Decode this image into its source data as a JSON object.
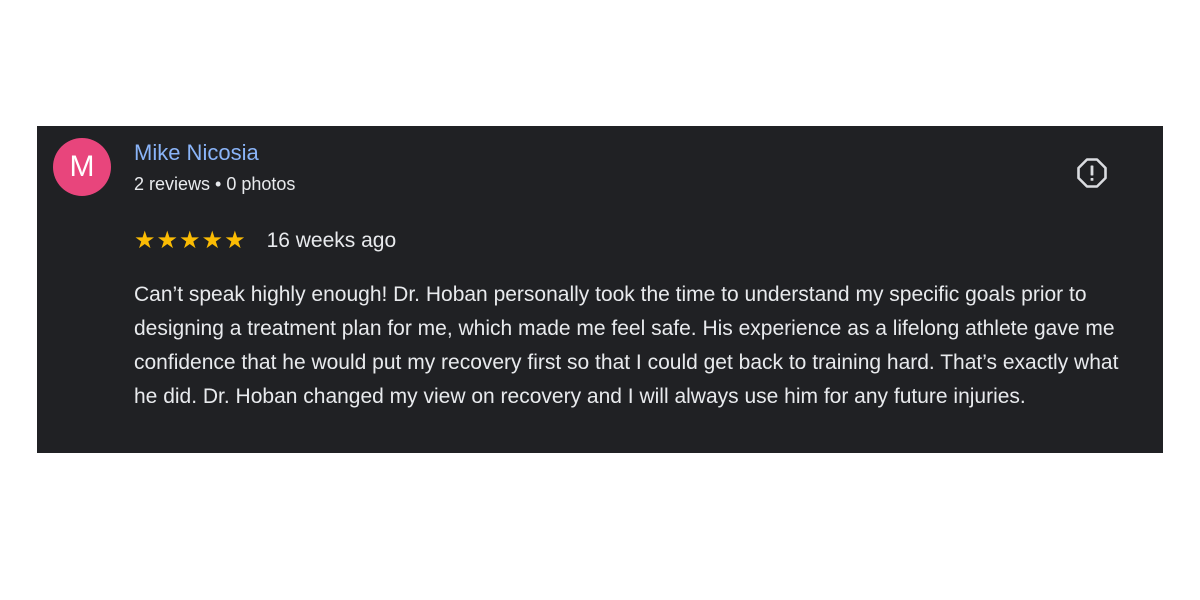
{
  "review": {
    "avatar_letter": "M",
    "avatar_color": "#e8457c",
    "reviewer_name": "Mike Nicosia",
    "name_color": "#8ab4f8",
    "reviewer_meta": "2 reviews • 0 photos",
    "rating": 5,
    "star_glyph": "★",
    "star_color": "#fbbc04",
    "date": "16 weeks ago",
    "text": "Can’t speak highly enough! Dr. Hoban personally took the time to understand my specific goals prior to designing a treatment plan for me, which made me feel safe. His experience as a lifelong athlete gave me confidence that he would put my recovery first so that I could get back to training hard. That’s exactly what he did. Dr. Hoban changed my view on recovery and I will always use him for any future injuries.",
    "flag_icon": "report-icon"
  },
  "colors": {
    "card_background": "#202124",
    "text_primary": "#e8eaed"
  }
}
